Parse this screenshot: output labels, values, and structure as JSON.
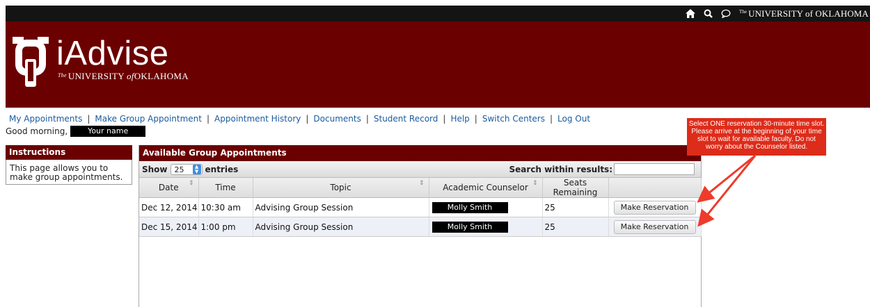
{
  "topbar": {
    "home_icon": "home-icon",
    "search_icon": "search-icon",
    "chat_icon": "chat-bubble-icon",
    "org_prefix": "The",
    "org_name": "UNIVERSITY of OKLAHOMA"
  },
  "banner": {
    "app_title": "iAdvise",
    "subtitle_prefix": "The",
    "subtitle_main": "UNIVERSITY",
    "subtitle_of": "of",
    "subtitle_end": "OKLAHOMA"
  },
  "nav": {
    "items": [
      "My Appointments",
      "Make Group Appointment",
      "Appointment History",
      "Documents",
      "Student Record",
      "Help",
      "Switch Centers",
      "Log Out"
    ],
    "separator": "|"
  },
  "greeting": {
    "text": "Good morning,",
    "name": "Your name"
  },
  "annotation": {
    "text": "Select ONE reservation 30-minute time slot. Please arrive at the beginning of your time slot to wait for available faculty. Do not worry about the Counselor listed."
  },
  "instructions": {
    "title": "Instructions",
    "body": "This page allows you to make group appointments."
  },
  "available": {
    "title": "Available Group Appointments",
    "show_label": "Show",
    "entries_value": "25",
    "entries_label": "entries",
    "search_label": "Search within results:",
    "search_value": "",
    "columns": [
      "Date",
      "Time",
      "Topic",
      "Academic Counselor",
      "Seats Remaining",
      ""
    ],
    "rows": [
      {
        "date": "Dec 12, 2014",
        "time": "10:30 am",
        "topic": "Advising Group Session",
        "counselor": "Molly Smith",
        "seats": "25",
        "action": "Make Reservation"
      },
      {
        "date": "Dec 15, 2014",
        "time": "1:00 pm",
        "topic": "Advising Group Session",
        "counselor": "Molly Smith",
        "seats": "25",
        "action": "Make Reservation"
      }
    ]
  },
  "colors": {
    "brand": "#6b0000",
    "topbar": "#141414",
    "link": "#1a5a9e",
    "annotation": "#dd2c1a"
  }
}
